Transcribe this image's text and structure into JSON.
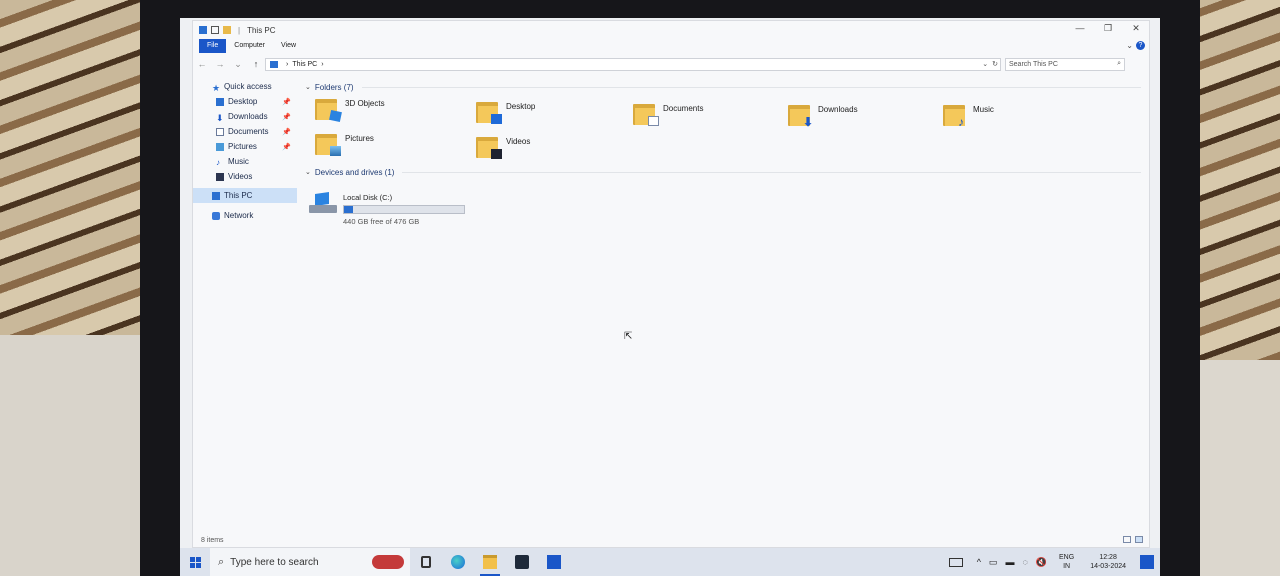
{
  "window": {
    "title": "This PC",
    "qa_separator": "|",
    "controls": [
      "—",
      "❐",
      "✕"
    ]
  },
  "ribbon": {
    "tabs": [
      "File",
      "Computer",
      "View"
    ],
    "help": "?",
    "collapse": "⌄"
  },
  "address": {
    "path": "This PC",
    "separator": "›",
    "dropdown": "⌄",
    "refresh": "↻",
    "back": "←",
    "forward": "→",
    "recent": "⌄",
    "up": "↑"
  },
  "search": {
    "placeholder": "Search This PC",
    "icon": "⌕"
  },
  "sidebar": {
    "quick_access": "Quick access",
    "items": [
      {
        "label": "Desktop",
        "pinned": true
      },
      {
        "label": "Downloads",
        "pinned": true
      },
      {
        "label": "Documents",
        "pinned": true
      },
      {
        "label": "Pictures",
        "pinned": true
      },
      {
        "label": "Music",
        "pinned": false
      },
      {
        "label": "Videos",
        "pinned": false
      }
    ],
    "this_pc": "This PC",
    "network": "Network",
    "pin_glyph": "📌"
  },
  "groups": {
    "folders_header": "Folders (7)",
    "devices_header": "Devices and drives (1)",
    "chevron": "⌄"
  },
  "folders": [
    {
      "label": "3D Objects",
      "icon": "3d-objects-folder-icon"
    },
    {
      "label": "Desktop",
      "icon": "desktop-folder-icon"
    },
    {
      "label": "Documents",
      "icon": "documents-folder-icon"
    },
    {
      "label": "Downloads",
      "icon": "downloads-folder-icon"
    },
    {
      "label": "Music",
      "icon": "music-folder-icon"
    },
    {
      "label": "Pictures",
      "icon": "pictures-folder-icon"
    },
    {
      "label": "Videos",
      "icon": "videos-folder-icon"
    }
  ],
  "drive": {
    "name": "Local Disk (C:)",
    "free_text": "440 GB free of 476 GB",
    "used_fraction": 0.076
  },
  "status": {
    "items": "8 items"
  },
  "taskbar": {
    "search_placeholder": "Type here to search",
    "language": "ENG",
    "region": "IN",
    "time": "12:28",
    "date": "14-03-2024"
  },
  "colors": {
    "accent": "#1a56c8",
    "folder": "#f4c85a",
    "selection": "#cce0f7"
  }
}
